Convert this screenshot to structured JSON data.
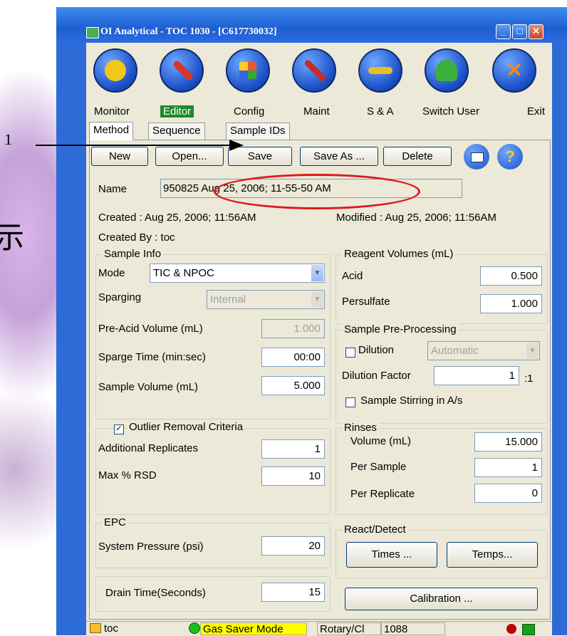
{
  "annotation": {
    "number": "1",
    "glyph": "示"
  },
  "window": {
    "title": "OI Analytical - TOC 1030 - [C617730032]",
    "min": "_",
    "max": "□",
    "close": "✕"
  },
  "toolbar": [
    {
      "label": "Monitor",
      "icon": "gauge-icon",
      "color": "#f2c818"
    },
    {
      "label": "Editor",
      "icon": "pencil-icon",
      "color": "#d8342c"
    },
    {
      "label": "Config",
      "icon": "grid-icon",
      "color": "#2a9d2a"
    },
    {
      "label": "Maint",
      "icon": "screwdriver-icon",
      "color": "#c92a2a"
    },
    {
      "label": "S & A",
      "icon": "key-icon",
      "color": "#e8c020"
    },
    {
      "label": "Switch User",
      "icon": "users-icon",
      "color": "#3cb03c"
    },
    {
      "label": "Exit",
      "icon": "close-icon",
      "color": "#f08a20"
    }
  ],
  "tabs": [
    "Method",
    "Sequence",
    "Sample IDs"
  ],
  "actions": {
    "new": "New",
    "open": "Open...",
    "save": "Save",
    "save_as": "Save As ...",
    "delete": "Delete",
    "print_icon": "printer-icon",
    "help": "?"
  },
  "method": {
    "name_label": "Name",
    "name_value": "950825  Aug 25, 2006; 11-55-50 AM",
    "created": "Created : Aug 25, 2006; 11:56AM",
    "modified": "Modified : Aug 25, 2006; 11:56AM",
    "created_by": "Created By : toc"
  },
  "sample_info": {
    "title": "Sample Info",
    "mode_label": "Mode",
    "mode_value": "TIC & NPOC",
    "sparging_label": "Sparging",
    "sparging_value": "Internal",
    "pre_acid_label": "Pre-Acid Volume (mL)",
    "pre_acid_value": "1.000",
    "sparge_time_label": "Sparge Time (min:sec)",
    "sparge_time_value": "00:00",
    "sample_volume_label": "Sample Volume (mL)",
    "sample_volume_value": "5.000"
  },
  "reagent": {
    "title": "Reagent Volumes (mL)",
    "acid_label": "Acid",
    "acid_value": "0.500",
    "persulfate_label": "Persulfate",
    "persulfate_value": "1.000"
  },
  "preprocessing": {
    "title": "Sample Pre-Processing",
    "dilution_label": "Dilution",
    "dilution_mode": "Automatic",
    "dilution_factor_label": "Dilution Factor",
    "dilution_factor_value": "1",
    "dilution_factor_suffix": ":1",
    "stirring_label": "Sample Stirring in A/s"
  },
  "outlier": {
    "title": "Outlier Removal Criteria",
    "check": "✓",
    "replicates_label": "Additional Replicates",
    "replicates_value": "1",
    "rsd_label": "Max % RSD",
    "rsd_value": "10"
  },
  "rinses": {
    "title": "Rinses",
    "volume_label": "Volume (mL)",
    "volume_value": "15.000",
    "per_sample_label": "Per Sample",
    "per_sample_value": "1",
    "per_replicate_label": "Per Replicate",
    "per_replicate_value": "0"
  },
  "epc": {
    "title": "EPC",
    "pressure_label": "System Pressure (psi)",
    "pressure_value": "20"
  },
  "react": {
    "title": "React/Detect",
    "times": "Times ...",
    "temps": "Temps..."
  },
  "drain": {
    "label": "Drain Time(Seconds)",
    "value": "15"
  },
  "calibration": "Calibration ...",
  "status": {
    "user": "toc",
    "mode": "Gas Saver Mode",
    "sampler": "Rotary/Cl",
    "count": "1088"
  }
}
